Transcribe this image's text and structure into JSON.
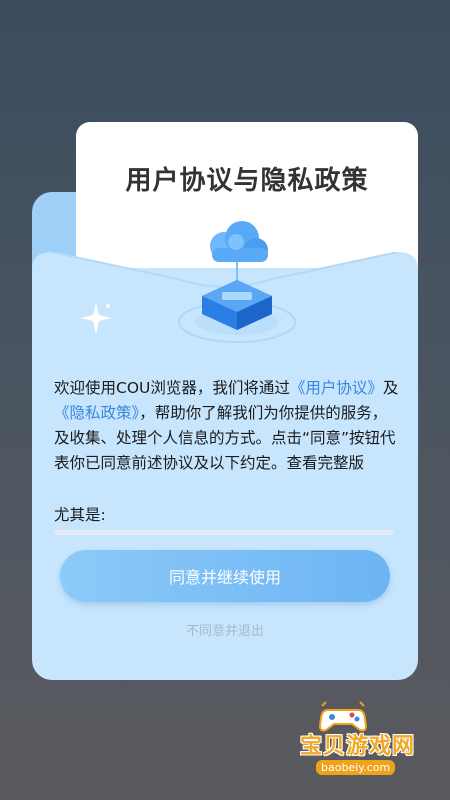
{
  "dialog": {
    "title": "用户协议与隐私政策",
    "text_before": "欢迎使用COU浏览器，我们将通过",
    "link_user_agreement": "《用户协议》",
    "text_and": "及",
    "link_privacy_policy": "《隐私政策》",
    "text_after": "，帮助你了解我们为你提供的服务，及收集、处理个人信息的方式。点击“同意”按钮代表你已同意前述协议及以下约定。查看完整版",
    "special_note": "尤其是:",
    "agree_button": "同意并继续使用",
    "decline_link": "不同意并退出"
  },
  "watermark": {
    "logo_text": "宝贝游戏网",
    "url": "baobeiy.com"
  },
  "colors": {
    "accent": "#3a87e0",
    "card": "#c7e5fd",
    "button": "#7bbff6"
  },
  "icons": [
    "cloud-server-icon",
    "sparkle-icon",
    "gamepad-icon"
  ]
}
